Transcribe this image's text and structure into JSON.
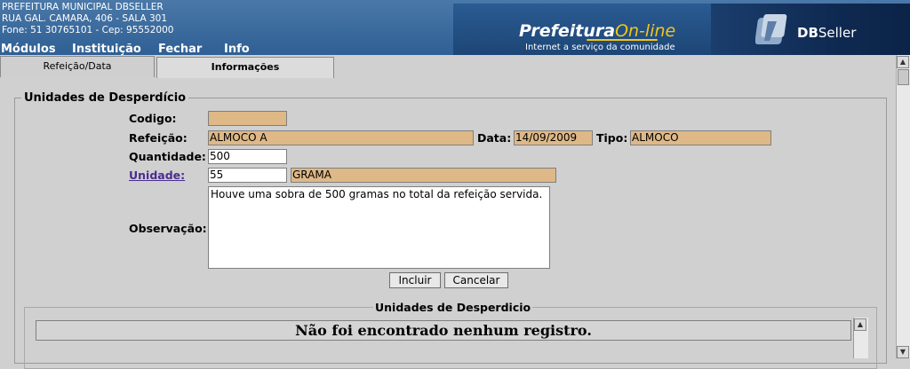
{
  "header": {
    "org_lines": [
      "PREFEITURA MUNICIPAL DBSELLER",
      "RUA GAL. CAMARA, 406 - SALA 301",
      "Fone: 51 30765101  -  Cep: 95552000"
    ],
    "menu": [
      "Módulos",
      "Instituição",
      "Fechar",
      "Info"
    ],
    "brand_title": "Prefeitura",
    "brand_title_accent": "On-line",
    "brand_subtitle": "Internet a serviço da comunidade",
    "vendor_bold": "DB",
    "vendor_rest": "Seller",
    "vendor_logo_icon": "dbseller-logo-icon"
  },
  "tabs": [
    {
      "label": "Refeição/Data",
      "active": false
    },
    {
      "label": "Informações",
      "active": true
    }
  ],
  "form": {
    "legend": "Unidades de Desperdício",
    "codigo_label": "Codigo:",
    "codigo_value": "",
    "refeicao_label": "Refeição:",
    "refeicao_value": "ALMOCO A",
    "data_label": "Data:",
    "data_value": "14/09/2009",
    "tipo_label": "Tipo:",
    "tipo_value": "ALMOCO",
    "quantidade_label": "Quantidade:",
    "quantidade_value": "500",
    "unidade_label": "Unidade:",
    "unidade_code": "55",
    "unidade_name": "GRAMA",
    "observacao_label": "Observação:",
    "observacao_value": "Houve uma sobra de 500 gramas no total da refeição servida.",
    "incluir_label": "Incluir",
    "cancelar_label": "Cancelar"
  },
  "grid": {
    "legend": "Unidades de Desperdicio",
    "empty_message": "Não foi encontrado nenhum registro."
  },
  "colors": {
    "readonly_field": "#deb887",
    "header_blue": "#3a6a9e",
    "brand_accent": "#f5c518"
  }
}
